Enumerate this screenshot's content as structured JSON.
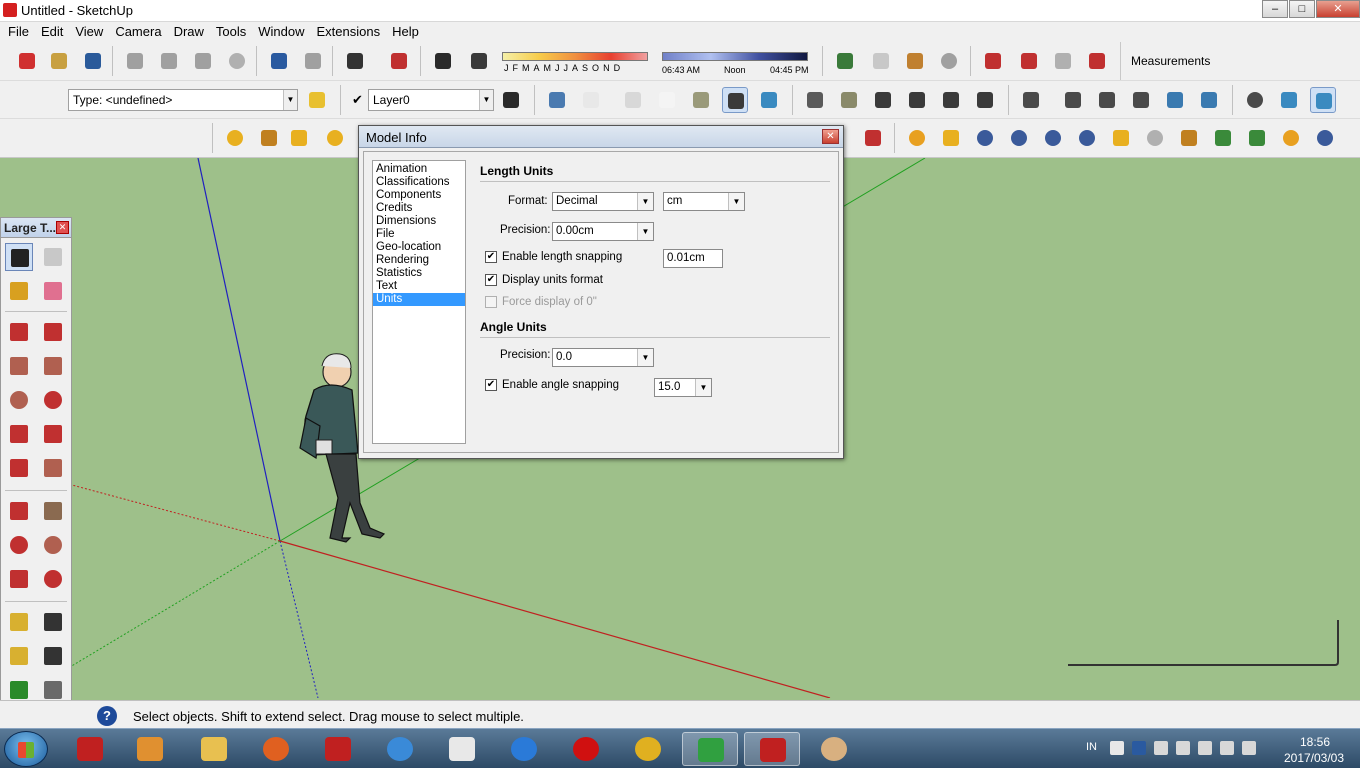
{
  "window": {
    "title": "Untitled - SketchUp",
    "min": "–",
    "max": "□",
    "close": "✕"
  },
  "menu": [
    "File",
    "Edit",
    "View",
    "Camera",
    "Draw",
    "Tools",
    "Window",
    "Extensions",
    "Help"
  ],
  "toolbar": {
    "type_combo": "Type: <undefined>",
    "layer_check": "✔",
    "layer_combo": "Layer0",
    "months": [
      "J",
      "F",
      "M",
      "A",
      "M",
      "J",
      "J",
      "A",
      "S",
      "O",
      "N",
      "D"
    ],
    "time_start": "06:43 AM",
    "time_noon": "Noon",
    "time_end": "04:45 PM",
    "measurements_label": "Measurements",
    "combo_arrow": "▼"
  },
  "large_tools": {
    "title": "Large T...",
    "close": "✕"
  },
  "dialog": {
    "title": "Model Info",
    "close": "✕",
    "categories": [
      "Animation",
      "Classifications",
      "Components",
      "Credits",
      "Dimensions",
      "File",
      "Geo-location",
      "Rendering",
      "Statistics",
      "Text",
      "Units"
    ],
    "selected_category": "Units",
    "length": {
      "heading": "Length Units",
      "format_label": "Format:",
      "format_value": "Decimal",
      "unit_value": "cm",
      "precision_label": "Precision:",
      "precision_value": "0.00cm",
      "snap_label": "Enable length snapping",
      "snap_value": "0.01cm",
      "display_label": "Display units format",
      "force_label": "Force display of 0\"",
      "check": "✔"
    },
    "angle": {
      "heading": "Angle Units",
      "precision_label": "Precision:",
      "precision_value": "0.0",
      "snap_label": "Enable angle snapping",
      "snap_value": "15.0"
    },
    "arrow": "▼"
  },
  "status": {
    "help": "?",
    "message": "Select objects. Shift to extend select. Drag mouse to select multiple."
  },
  "taskbar": {
    "lang": "IN",
    "time": "18:56",
    "date": "2017/03/03"
  },
  "colors": {
    "accent": "#3399ff",
    "viewport": "#9ec08a",
    "red_axis": "#c02020",
    "green_axis": "#20a020",
    "blue_axis": "#2020c0"
  }
}
